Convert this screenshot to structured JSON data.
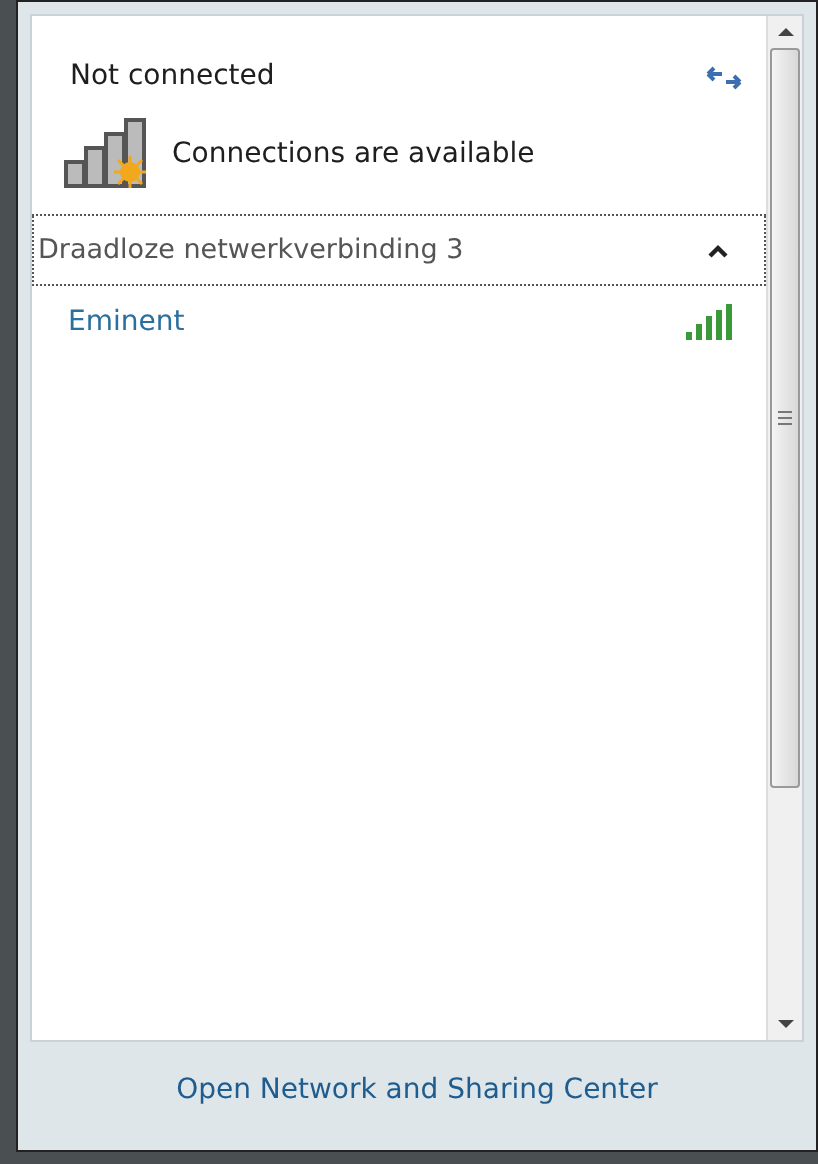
{
  "status": {
    "title": "Not connected",
    "message": "Connections are available"
  },
  "section": {
    "title": "Draadloze netwerkverbinding 3",
    "expanded": true
  },
  "networks": [
    {
      "name": "Eminent"
    }
  ],
  "footer": {
    "link": "Open Network and Sharing Center"
  }
}
